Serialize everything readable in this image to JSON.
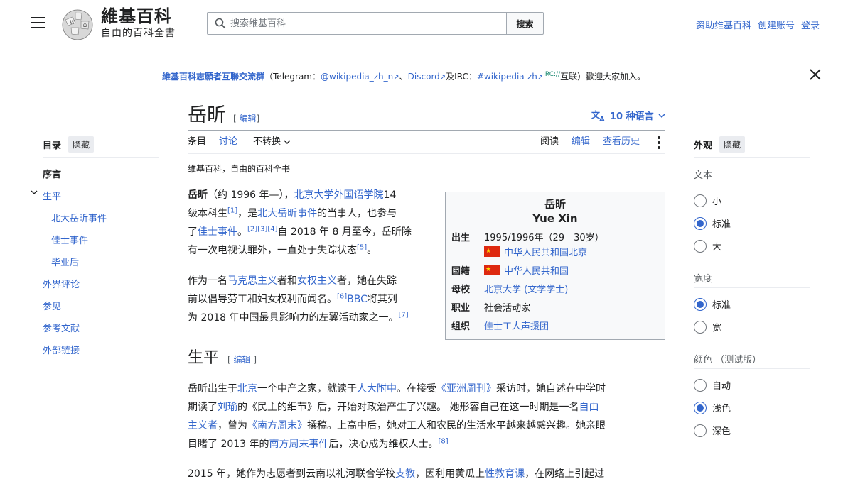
{
  "header": {
    "wordmark_line1": "維基百科",
    "wordmark_line2": "自由的百科全書",
    "search_placeholder": "搜索维基百科",
    "search_button": "搜索",
    "links": [
      "资助维基百科",
      "创建账号",
      "登录"
    ]
  },
  "banner": {
    "group": "維基百科志願者互聯交流群",
    "p1": "（Telegram：",
    "telegram": "@wikipedia_zh_n",
    "sep1": "、",
    "discord": "Discord",
    "and": "及IRC：",
    "irc": "#wikipedia-zh",
    "irc_sup": "IRC://",
    "tail": "互联）歡迎大家加入。"
  },
  "title": {
    "text": "岳昕",
    "edit_open": "[",
    "edit": "编辑",
    "edit_close": "]",
    "languages": "10 种语言"
  },
  "tabs": {
    "article": "条目",
    "talk": "讨论",
    "variant": "不转换",
    "read": "阅读",
    "edit": "编辑",
    "history": "查看历史"
  },
  "tagline": "维基百科，自由的百科全书",
  "toc": {
    "title": "目录",
    "hide": "隐藏",
    "items": [
      "序言",
      "生平",
      "北大岳昕事件",
      "佳士事件",
      "毕业后",
      "外界评论",
      "参见",
      "参考文献",
      "外部链接"
    ]
  },
  "infobox": {
    "name_zh": "岳昕",
    "name_en": "Yue Xin",
    "born_label": "出生",
    "born_date": "1995/1996年（29—30岁）",
    "born_place": "中华人民共和国北京",
    "nation_label": "国籍",
    "nation": "中华人民共和国",
    "school_label": "母校",
    "school": "北京大学",
    "school_degree": "(文学学士)",
    "job_label": "职业",
    "job": "社会活动家",
    "org_label": "组织",
    "org": "佳士工人声援团"
  },
  "intro": {
    "l1_name": "岳昕",
    "l1_a": "（约 1996 年—），",
    "l1_link": "北京大学外国语学院",
    "l1_b": "14",
    "l2_a": "级本科生",
    "ref1": "[1]",
    "l2_b": "，是",
    "l2_link": "北大岳昕事件",
    "l2_c": "的当事人，也参与",
    "l3_a": "了",
    "l3_link": "佳士事件",
    "l3_b": "。",
    "ref234": "[2][3][4]",
    "l3_c": "自 2018 年 8 月至今，岳昕除",
    "l4_a": "有一次电视认罪外，一直处于失踪状态",
    "ref5": "[5]",
    "l4_b": "。",
    "p2_l1_a": "作为一名",
    "p2_marx": "马克思主义",
    "p2_and": "者和",
    "p2_fem": "女权主义",
    "p2_l1_b": "者，她在失踪",
    "p2_l2_a": "前以倡导劳工和妇女权利而闻名。",
    "ref6": "[6]",
    "p2_bbc": "BBC",
    "p2_l2_b": "将其列",
    "p2_l3": "为 2018 年中国最具影响力的左翼活动家之一。",
    "ref7": "[7]"
  },
  "section": {
    "title": "生平",
    "edit": "编辑",
    "l1_a": "岳昕出生于",
    "beijing": "北京",
    "l1_b": "一个中产之家，就读于",
    "rdfz": "人大附中",
    "l1_c": "。在接受",
    "asiaweek": "《亚洲周刊》",
    "l1_d": "采访时，她自述在中学时",
    "l2_a": "期读了",
    "liuyu": "刘瑜",
    "l2_b": "的《民主的细节》后，开始对政治产生了兴趣。 她形容自己在这一时期是一名",
    "ziyou": "自由",
    "l3_zhuyi": "主义者",
    "l3_a": "，曾为",
    "nanfang": "《南方周末》",
    "l3_b": "撰稿。上高中后，她对工人和农民的生活水平越来越感兴趣。她亲眼",
    "l4_a": "目睹了 2013 年的",
    "nfevent": "南方周末事件",
    "l4_b": "后，决心成为维权人士。",
    "ref8": "[8]",
    "p2_a": "2015 年，她作为志愿者到云南以礼河联合学校",
    "zhijiao": "支教",
    "p2_b": "，因利用黄瓜上",
    "xingjiaoyu": "性教育课",
    "p2_c": "，在网络上引起过"
  },
  "appearance": {
    "title": "外观",
    "hide": "隐藏",
    "text_label": "文本",
    "text_opts": [
      "小",
      "标准",
      "大"
    ],
    "width_label": "宽度",
    "width_opts": [
      "标准",
      "宽"
    ],
    "color_label": "颜色",
    "color_note": "（测试版）",
    "color_opts": [
      "自动",
      "浅色",
      "深色"
    ]
  },
  "colors": {
    "link": "#3366cc",
    "text": "#202122",
    "border": "#a2a9b1"
  }
}
